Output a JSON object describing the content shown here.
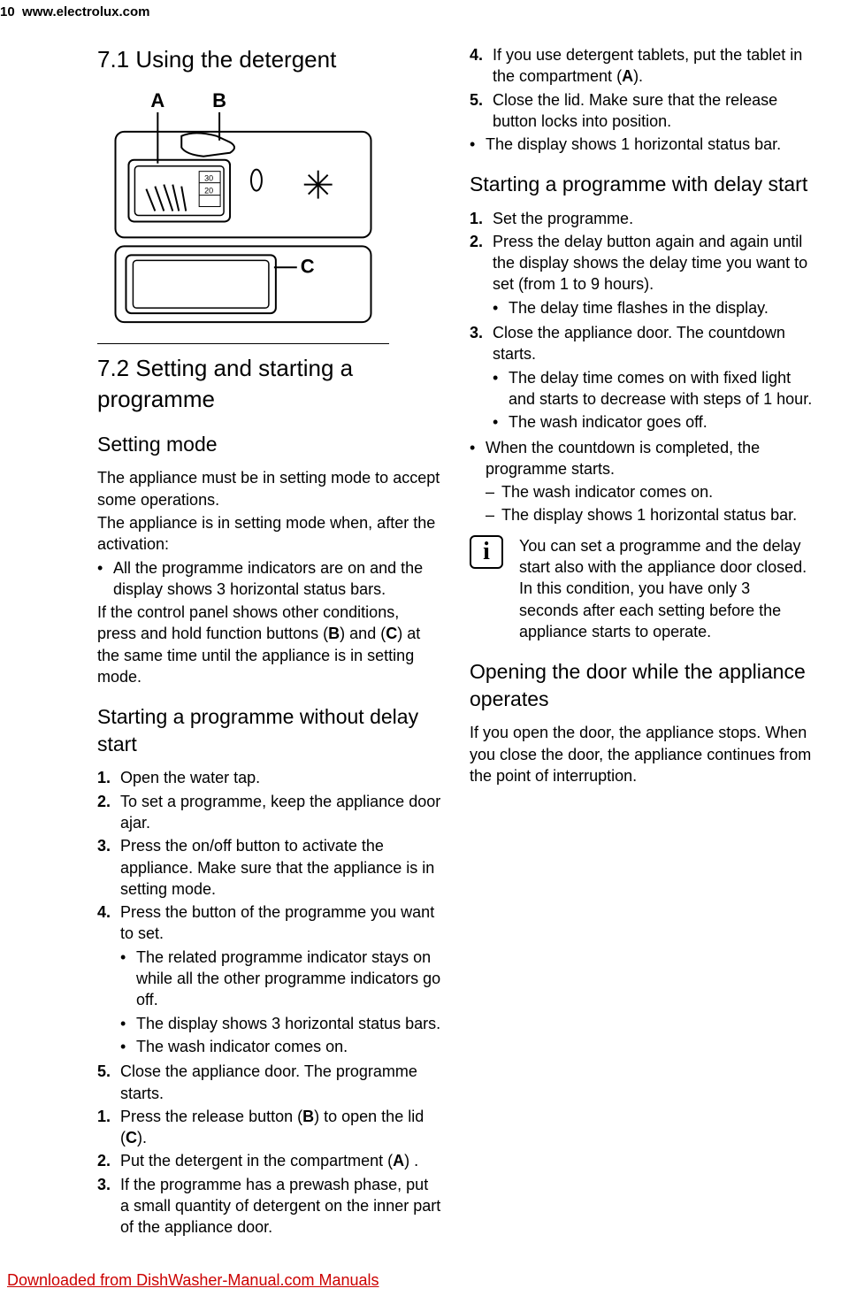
{
  "header": {
    "page_num": "10",
    "url": "www.electrolux.com"
  },
  "s71": {
    "title": "7.1 Using the detergent",
    "labels": {
      "A": "A",
      "B": "B",
      "C": "C",
      "n30": "30",
      "n20": "20"
    }
  },
  "s72": {
    "title": "7.2 Setting and starting a programme",
    "setting_mode": {
      "title": "Setting mode",
      "p1": "The appliance must be in setting mode to accept some operations.",
      "p2": "The appliance is in setting mode when, after the activation:",
      "b1": "All the programme indicators are on and the display shows 3 horizontal status bars.",
      "p3_a": "If the control panel shows other conditions, press and hold function buttons (",
      "p3_b": ") and (",
      "p3_c": ") at the same time until the appliance is in setting mode."
    },
    "without_delay": {
      "title": "Starting a programme without delay start",
      "s1": "Open the water tap.",
      "s2": "To set a programme, keep the appliance door ajar.",
      "s3": "Press the on/off button to activate the appliance. Make sure that the appliance is in setting mode.",
      "s4": "Press the button of the programme you want to set.",
      "s4b1": "The related programme indicator stays on while all the other programme indicators go off.",
      "s4b2": "The display shows 3 horizontal status bars.",
      "s4b3": "The wash indicator comes on.",
      "s5": "Close the appliance door. The programme starts.",
      "s5b1": "The display shows 1 horizontal status bar."
    },
    "detergent_steps": {
      "s1_a": "Press the release button (",
      "s1_b": ") to open the lid (",
      "s1_c": ").",
      "s2_a": "Put the detergent in the compartment (",
      "s2_b": ") .",
      "s3": "If the programme has a prewash phase, put a small quantity of detergent on the inner part of the appliance door.",
      "s4_a": "If you use detergent tablets, put the tablet in the compartment (",
      "s4_b": ").",
      "s5": "Close the lid. Make sure that the release button locks into position."
    },
    "with_delay": {
      "title": "Starting a programme with delay start",
      "s1": "Set the programme.",
      "s2": "Press the delay button again and again until the display shows the delay time you want to set (from 1 to 9 hours).",
      "s2b1": "The delay time flashes in the display.",
      "s3": "Close the appliance door. The countdown starts.",
      "s3b1": "The delay time comes on with fixed light and starts to decrease with steps of 1 hour.",
      "s3b2": "The wash indicator goes off.",
      "b1": "When the countdown is completed, the programme starts.",
      "b1d1": "The wash indicator comes on.",
      "b1d2": "The display shows 1 horizontal status bar."
    },
    "info": "You can set a programme and the delay start also with the appliance door closed. In this condition, you have only 3 seconds after each setting before the appliance starts to operate.",
    "opening": {
      "title": "Opening the door while the appliance operates",
      "p1": "If you open the door, the appliance stops. When you close the door, the appliance continues from the point of interruption."
    }
  },
  "footer": {
    "text": "Downloaded from DishWasher-Manual.com Manuals",
    "href": "#"
  }
}
